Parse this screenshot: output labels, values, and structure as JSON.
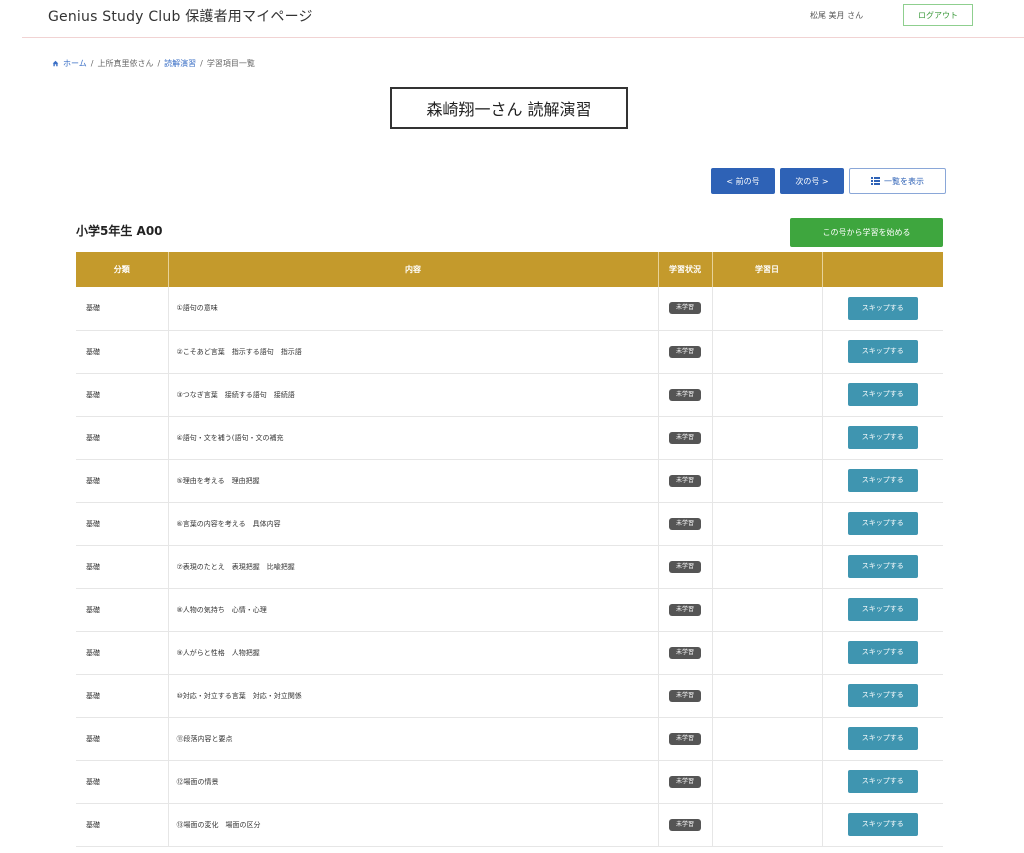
{
  "header": {
    "brand": "Genius Study Club 保護者用マイページ",
    "user_name": "松尾 美月 さん",
    "logout_label": "ログアウト"
  },
  "breadcrumb": {
    "home": "ホーム",
    "student": "上所真里依さん",
    "course": "読解演習",
    "current": "学習項目一覧",
    "separator": "/"
  },
  "page": {
    "title": "森崎翔一さん 読解演習"
  },
  "nav": {
    "prev_label": "< 前の号",
    "next_label": "次の号 >",
    "list_label": "一覧を表示"
  },
  "section": {
    "title": "小学5年生 A00",
    "start_label": "この号から学習を始める"
  },
  "table": {
    "headers": [
      "分類",
      "内容",
      "学習状況",
      "学習日",
      ""
    ],
    "rows": [
      {
        "category": "基礎",
        "content": "①語句の意味",
        "status": "未学習",
        "date": "",
        "action": "スキップする"
      },
      {
        "category": "基礎",
        "content": "②こそあど言葉　指示する語句　指示語",
        "status": "未学習",
        "date": "",
        "action": "スキップする"
      },
      {
        "category": "基礎",
        "content": "③つなぎ言葉　接続する語句　接続語",
        "status": "未学習",
        "date": "",
        "action": "スキップする"
      },
      {
        "category": "基礎",
        "content": "④語句・文を補う(語句・文の補充",
        "status": "未学習",
        "date": "",
        "action": "スキップする"
      },
      {
        "category": "基礎",
        "content": "⑤理由を考える　理由把握",
        "status": "未学習",
        "date": "",
        "action": "スキップする"
      },
      {
        "category": "基礎",
        "content": "⑥言葉の内容を考える　具体内容",
        "status": "未学習",
        "date": "",
        "action": "スキップする"
      },
      {
        "category": "基礎",
        "content": "⑦表現のたとえ　表現把握　比喩把握",
        "status": "未学習",
        "date": "",
        "action": "スキップする"
      },
      {
        "category": "基礎",
        "content": "⑧人物の気持ち　心情・心理",
        "status": "未学習",
        "date": "",
        "action": "スキップする"
      },
      {
        "category": "基礎",
        "content": "⑨人がらと性格　人物把握",
        "status": "未学習",
        "date": "",
        "action": "スキップする"
      },
      {
        "category": "基礎",
        "content": "⑩対応・対立する言葉　対応・対立関係",
        "status": "未学習",
        "date": "",
        "action": "スキップする"
      },
      {
        "category": "基礎",
        "content": "⑪段落内容と要点",
        "status": "未学習",
        "date": "",
        "action": "スキップする"
      },
      {
        "category": "基礎",
        "content": "⑫場面の情景",
        "status": "未学習",
        "date": "",
        "action": "スキップする"
      },
      {
        "category": "基礎",
        "content": "⑬場面の変化　場面の区分",
        "status": "未学習",
        "date": "",
        "action": "スキップする"
      }
    ]
  },
  "colors": {
    "header_gold": "#c49a2c",
    "primary_blue": "#2e62b6",
    "start_green": "#3ea63e",
    "skip_teal": "#3f95b0"
  }
}
